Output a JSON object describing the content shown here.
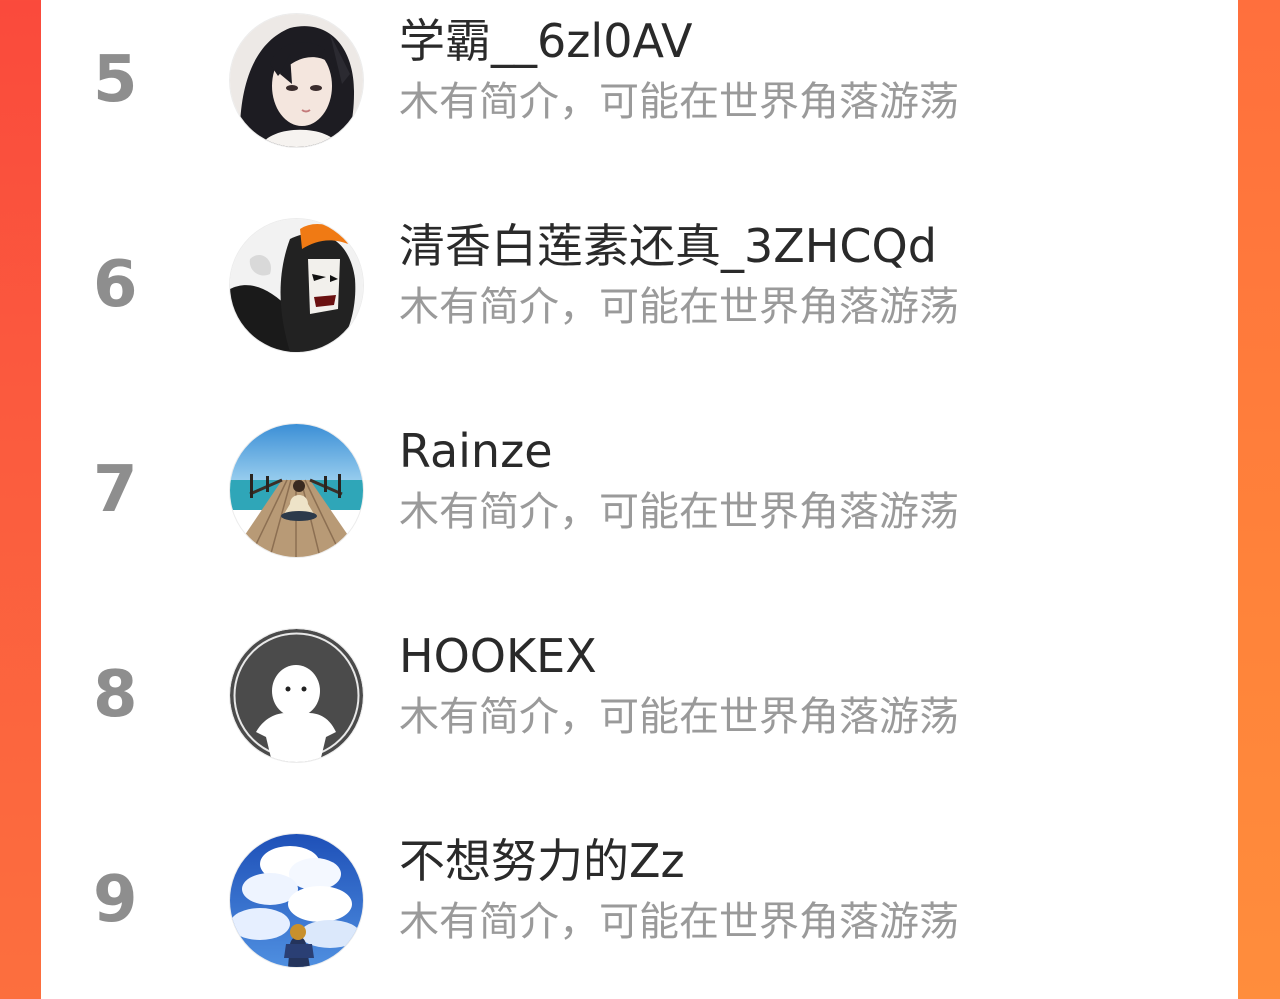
{
  "theme": {
    "accent": "#fa4a3c",
    "accent_right": "#ff833a",
    "rank_color": "#8e8e8e",
    "name_color": "#2a2a2a",
    "bio_color": "#9a9a9a"
  },
  "ranking": [
    {
      "rank": "5",
      "name": "学霸__6zl0AV",
      "bio": "木有简介，可能在世界角落游荡",
      "avatar_icon": "anime-avatar-icon"
    },
    {
      "rank": "6",
      "name": "清香白莲素还真_3ZHCQd",
      "bio": "木有简介，可能在世界角落游荡",
      "avatar_icon": "masked-character-avatar-icon"
    },
    {
      "rank": "7",
      "name": "Rainze",
      "bio": "木有简介，可能在世界角落游荡",
      "avatar_icon": "pier-photo-avatar-icon"
    },
    {
      "rank": "8",
      "name": "HOOKEX",
      "bio": "木有简介，可能在世界角落游荡",
      "avatar_icon": "default-avatar-icon"
    },
    {
      "rank": "9",
      "name": "不想努力的Zz",
      "bio": "木有简介，可能在世界角落游荡",
      "avatar_icon": "sky-clouds-avatar-icon"
    }
  ]
}
